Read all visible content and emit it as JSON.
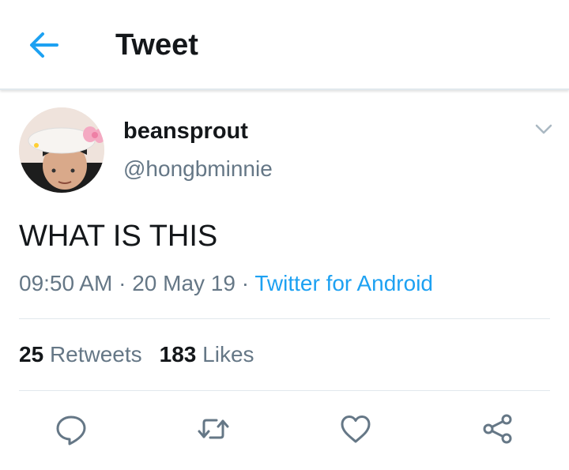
{
  "header": {
    "back_icon": "arrow-left-icon",
    "title": "Tweet"
  },
  "tweet": {
    "author": {
      "display_name": "beansprout",
      "handle": "@hongbminnie",
      "avatar": "profile-photo"
    },
    "text": "WHAT IS THIS",
    "time": "09:50 AM",
    "separator": "·",
    "date": "20 May 19",
    "source": "Twitter for Android",
    "stats": {
      "retweets_count": "25",
      "retweets_label": "Retweets",
      "likes_count": "183",
      "likes_label": "Likes"
    },
    "actions": [
      {
        "name": "reply",
        "icon": "reply-icon"
      },
      {
        "name": "retweet",
        "icon": "retweet-icon"
      },
      {
        "name": "like",
        "icon": "heart-icon"
      },
      {
        "name": "share",
        "icon": "share-icon"
      }
    ]
  },
  "colors": {
    "accent": "#1da1f2",
    "text_primary": "#14171a",
    "text_secondary": "#657786",
    "divider": "#e1e8ed"
  }
}
